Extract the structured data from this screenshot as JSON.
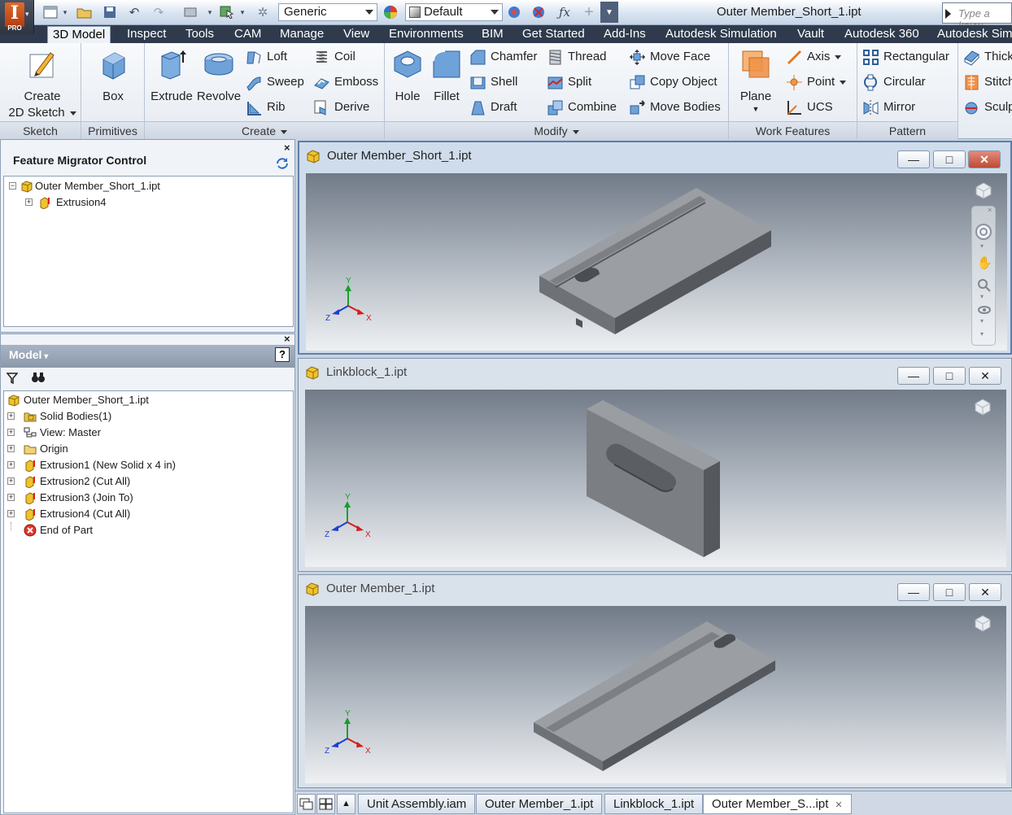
{
  "app": {
    "logo_letter": "I",
    "edition": "PRO"
  },
  "quick_access": {
    "material": "Generic",
    "appearance": "Default"
  },
  "window": {
    "title": "Outer Member_Short_1.ipt"
  },
  "search": {
    "placeholder": "Type a keyw"
  },
  "tabs": [
    "3D Model",
    "Inspect",
    "Tools",
    "CAM",
    "Manage",
    "View",
    "Environments",
    "BIM",
    "Get Started",
    "Add-Ins",
    "Autodesk Simulation",
    "Vault",
    "Autodesk 360",
    "Autodesk Sim"
  ],
  "ribbon": {
    "sketch": {
      "create_line1": "Create",
      "create_line2": "2D Sketch",
      "label": "Sketch"
    },
    "primitives": {
      "box": "Box",
      "label": "Primitives"
    },
    "create": {
      "extrude": "Extrude",
      "revolve": "Revolve",
      "loft": "Loft",
      "sweep": "Sweep",
      "rib": "Rib",
      "coil": "Coil",
      "emboss": "Emboss",
      "derive": "Derive",
      "label": "Create"
    },
    "modify": {
      "hole": "Hole",
      "fillet": "Fillet",
      "chamfer": "Chamfer",
      "shell": "Shell",
      "draft": "Draft",
      "thread": "Thread",
      "split": "Split",
      "combine": "Combine",
      "move_face": "Move Face",
      "copy_object": "Copy Object",
      "move_bodies": "Move Bodies",
      "label": "Modify"
    },
    "work_features": {
      "plane": "Plane",
      "axis": "Axis",
      "point": "Point",
      "ucs": "UCS",
      "label": "Work Features"
    },
    "pattern": {
      "rectangular": "Rectangular",
      "circular": "Circular",
      "mirror": "Mirror",
      "label": "Pattern"
    },
    "surface": {
      "thicken": "Thick",
      "stitch": "Stitch",
      "sculpt": "Sculp"
    }
  },
  "feature_migrator": {
    "title": "Feature Migrator Control",
    "close": "×",
    "tree": [
      "Outer Member_Short_1.ipt",
      "Extrusion4"
    ]
  },
  "model_browser": {
    "title": "Model",
    "close": "×",
    "help": "?",
    "tree": [
      "Outer Member_Short_1.ipt",
      "Solid Bodies(1)",
      "View: Master",
      "Origin",
      "Extrusion1 (New Solid x 4 in)",
      "Extrusion2 (Cut All)",
      "Extrusion3 (Join To)",
      "Extrusion4 (Cut All)",
      "End of Part"
    ]
  },
  "viewports": [
    {
      "title": "Outer Member_Short_1.ipt",
      "active": true
    },
    {
      "title": "Linkblock_1.ipt",
      "active": false
    },
    {
      "title": "Outer Member_1.ipt",
      "active": false
    }
  ],
  "triad": {
    "x": "X",
    "y": "Y",
    "z": "Z"
  },
  "window_buttons": {
    "min": "—",
    "max": "□",
    "close": "✕"
  },
  "doc_tabs": [
    "Unit Assembly.iam",
    "Outer Member_1.ipt",
    "Linkblock_1.ipt",
    "Outer Member_S...ipt"
  ],
  "colors": {
    "ribbon_tab_bar": "#2f3b4d",
    "active_viewport_border": "#5e7fa9",
    "part_gray": "#8a8d92",
    "axis_x": "#d11e1e",
    "axis_y": "#16a02a",
    "axis_z": "#1e3fd1"
  }
}
